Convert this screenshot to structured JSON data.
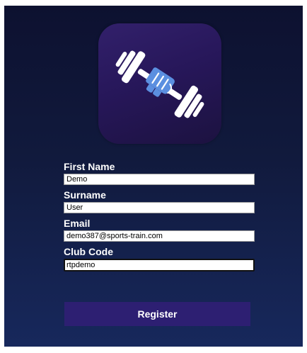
{
  "app": {
    "logo_icon": "dumbbell-icon",
    "colors": {
      "background_top": "#0d1130",
      "background_bottom": "#17285c",
      "logo_tile": "#2a1a5e",
      "accent_blue": "#5b8fe0",
      "button": "#2d1f72"
    }
  },
  "form": {
    "first_name": {
      "label": "First Name",
      "value": "Demo"
    },
    "surname": {
      "label": "Surname",
      "value": "User"
    },
    "email": {
      "label": "Email",
      "value": "demo387@sports-train.com"
    },
    "club_code": {
      "label": "Club Code",
      "value": "rtpdemo"
    },
    "register_label": "Register"
  }
}
